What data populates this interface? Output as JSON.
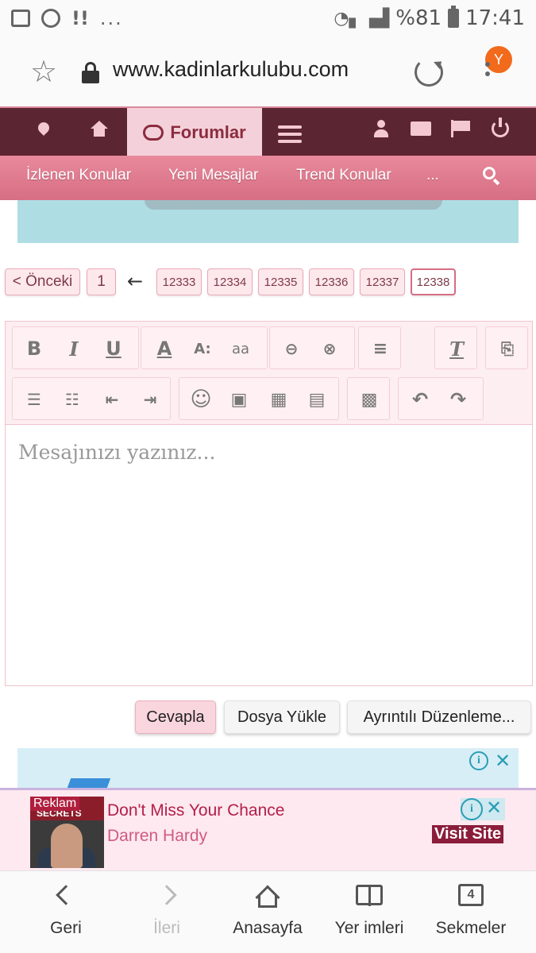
{
  "statusbar": {
    "battery": "%81",
    "time": "17:41",
    "more": "..."
  },
  "browser": {
    "url": "www.kadinlarkulubu.com",
    "avatar_letter": "Y"
  },
  "site_nav": {
    "forum_tab": "Forumlar",
    "sub_items": [
      "İzlenen Konular",
      "Yeni Mesajlar",
      "Trend Konular",
      "..."
    ]
  },
  "pagination": {
    "prev_label": "< Önceki",
    "first_page": "1",
    "jump_arrow": "←",
    "pages": [
      "12333",
      "12334",
      "12335",
      "12336",
      "12337",
      "12338"
    ],
    "current_page": "12338"
  },
  "editor": {
    "placeholder": "Mesajınızı yazınız...",
    "toolbar": {
      "bold": "B",
      "italic": "I",
      "underline": "U",
      "font_color": "A",
      "font_size": "A:",
      "font_family": "aa",
      "clear_format": "T"
    }
  },
  "actions": {
    "reply": "Cevapla",
    "upload": "Dosya Yükle",
    "advanced": "Ayrıntılı Düzenleme..."
  },
  "ad": {
    "label": "Reklam",
    "title": "Don't Miss Your Chance",
    "advertiser": "Darren Hardy",
    "cta": "Visit Site",
    "thumb_text": "SECRETS"
  },
  "bottom_nav": {
    "back": "Geri",
    "forward": "İleri",
    "home": "Anasayfa",
    "bookmarks": "Yer imleri",
    "tabs": "Sekmeler",
    "tab_count": "4"
  },
  "colors": {
    "site_header": "#5c2532",
    "subnav": "#d66e84",
    "accent": "#8b2c3f",
    "avatar": "#f26a1b"
  }
}
